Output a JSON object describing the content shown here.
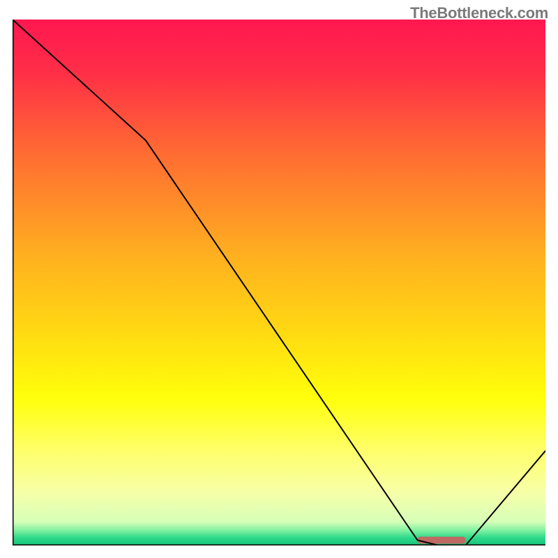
{
  "watermark": "TheBottleneck.com",
  "chart_data": {
    "type": "line",
    "title": "",
    "xlabel": "",
    "ylabel": "",
    "xlim": [
      0,
      100
    ],
    "ylim": [
      0,
      100
    ],
    "series": [
      {
        "name": "curve",
        "x": [
          0,
          25,
          76,
          80,
          85,
          100
        ],
        "values": [
          100,
          77,
          1,
          0,
          0,
          18
        ]
      }
    ],
    "marker": {
      "x_start": 76,
      "x_end": 85,
      "y": 1,
      "color": "#c06862"
    },
    "background_gradient": {
      "stops": [
        {
          "offset": 0.0,
          "color": "#ff1750"
        },
        {
          "offset": 0.1,
          "color": "#ff2e47"
        },
        {
          "offset": 0.25,
          "color": "#ff6a33"
        },
        {
          "offset": 0.45,
          "color": "#ffb01f"
        },
        {
          "offset": 0.6,
          "color": "#ffdb12"
        },
        {
          "offset": 0.72,
          "color": "#ffff0b"
        },
        {
          "offset": 0.82,
          "color": "#ffff6a"
        },
        {
          "offset": 0.9,
          "color": "#f6ffa8"
        },
        {
          "offset": 0.955,
          "color": "#d6ffb8"
        },
        {
          "offset": 0.972,
          "color": "#7df0a0"
        },
        {
          "offset": 0.985,
          "color": "#2fd98a"
        },
        {
          "offset": 1.0,
          "color": "#14c47a"
        }
      ]
    }
  }
}
